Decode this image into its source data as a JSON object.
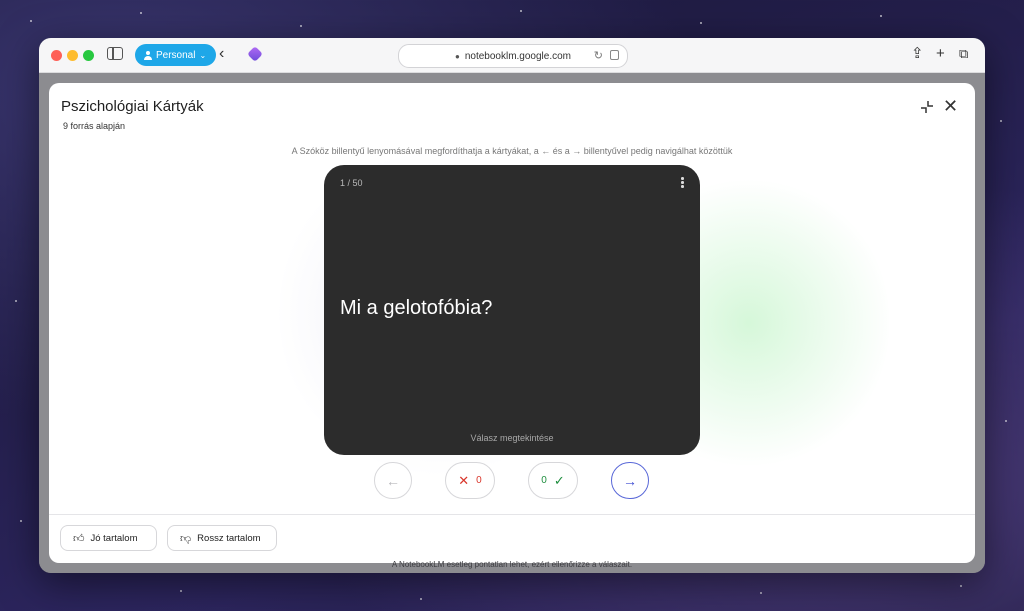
{
  "browser": {
    "profile_label": "Personal",
    "url": "notebooklm.google.com"
  },
  "modal": {
    "title": "Pszichológiai Kártyák",
    "subtitle": "9 forrás alapján",
    "hint": "A Szóköz billentyű lenyomásával megfordíthatja a kártyákat, a ← és a → billentyűvel pedig navigálhat közöttük"
  },
  "card": {
    "counter": "1 / 50",
    "question": "Mi a gelotofóbia?",
    "reveal_label": "Válasz megtekintése"
  },
  "controls": {
    "prev_icon": "←",
    "wrong_count": "0",
    "right_count": "0",
    "next_icon": "→"
  },
  "feedback": {
    "good_label": "Jó tartalom",
    "bad_label": "Rossz tartalom"
  },
  "footer_note": "A NotebookLM esetleg pontatlan lehet, ezért ellenőrizze a válaszait.",
  "colors": {
    "profile_accent": "#1ea7e8",
    "card_bg": "#2c2c2c",
    "wrong": "#d9362b",
    "right": "#1e8e3e",
    "next_accent": "#3c4bd2"
  }
}
